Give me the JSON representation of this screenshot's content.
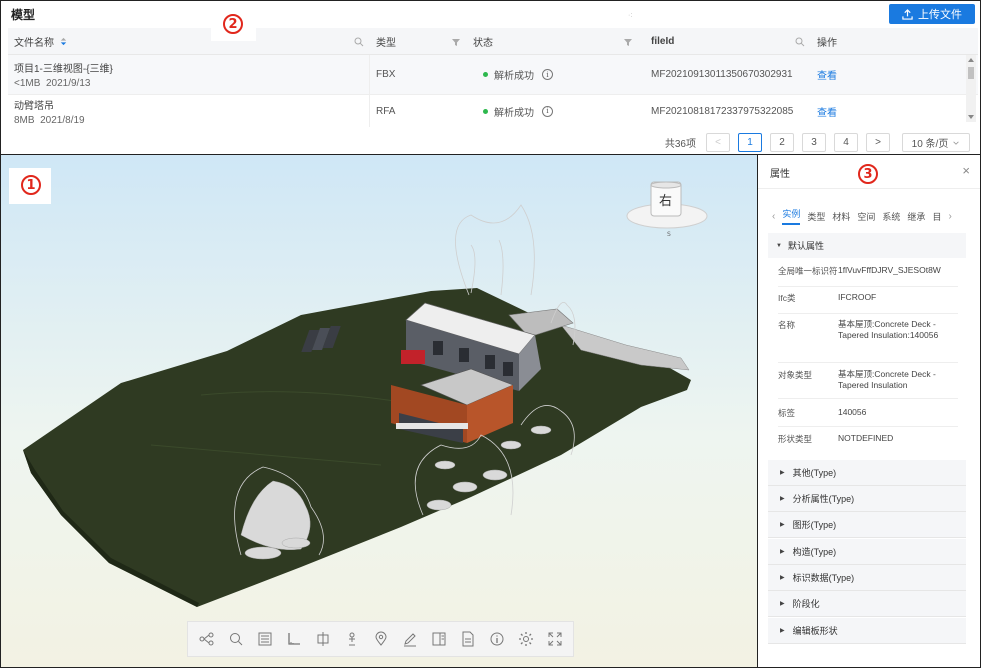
{
  "header": {
    "title": "模型",
    "upload_label": "上传文件"
  },
  "table": {
    "columns": {
      "name": "文件名称",
      "type": "类型",
      "status": "状态",
      "fileid": "fileId",
      "action": "操作"
    },
    "rows": [
      {
        "name": "项目1-三维视图-{三维}",
        "size": "<1MB",
        "date": "2021/9/13",
        "type": "FBX",
        "status": "解析成功",
        "fileid": "MF20210913011350670302931",
        "action": "查看"
      },
      {
        "name": "动臂塔吊",
        "size": "8MB",
        "date": "2021/8/19",
        "type": "RFA",
        "status": "解析成功",
        "fileid": "MF20210818172337975322085",
        "action": "查看"
      }
    ]
  },
  "pagination": {
    "total": "共36项",
    "prev": "<",
    "pages": [
      "1",
      "2",
      "3",
      "4"
    ],
    "current": "1",
    "next": ">",
    "page_size": "10 条/页"
  },
  "markers": {
    "viewer": "1",
    "table": "2",
    "props": "3"
  },
  "viewcube": {
    "face": "右",
    "compass": "S"
  },
  "toolbar": {
    "tools": [
      "model-tree-icon",
      "search-icon",
      "section-box-icon",
      "measure-angle-icon",
      "section-plane-icon",
      "walk-person-icon",
      "location-pin-icon",
      "markup-pen-icon",
      "properties-icon",
      "document-icon",
      "info-icon",
      "settings-gear-icon",
      "fullscreen-icon"
    ]
  },
  "props": {
    "title": "属性",
    "close": "×",
    "tabs": [
      "实例",
      "类型",
      "材料",
      "空间",
      "系统",
      "继承",
      "目"
    ],
    "active_tab": "实例",
    "default_group": "默认属性",
    "attributes": [
      {
        "key": "全局唯一标识符",
        "value": "1flVuvFffDJRV_SJESOt8W"
      },
      {
        "key": "Ifc类",
        "value": "IFCROOF"
      },
      {
        "key": "名称",
        "value": "基本屋顶:Concrete Deck - Tapered Insulation:140056"
      },
      {
        "key": "对象类型",
        "value": "基本屋顶:Concrete Deck - Tapered Insulation"
      },
      {
        "key": "标签",
        "value": "140056"
      },
      {
        "key": "形状类型",
        "value": "NOTDEFINED"
      }
    ],
    "sections": [
      "其他(Type)",
      "分析属性(Type)",
      "图形(Type)",
      "构造(Type)",
      "标识数据(Type)",
      "阶段化",
      "编辑板形状"
    ]
  },
  "colors": {
    "accent": "#1a7ae0",
    "success": "#2db84d",
    "marker": "#e1271c",
    "terrain": "#2f3a22",
    "wall_orange": "#b8552a"
  }
}
